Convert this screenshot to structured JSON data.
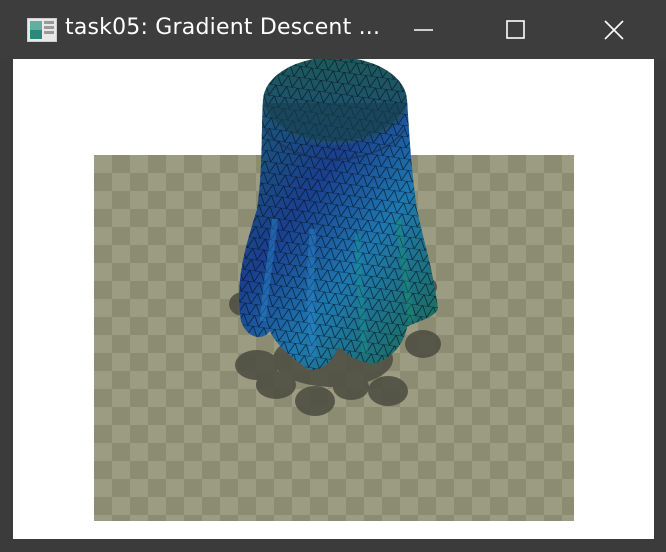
{
  "window": {
    "title": "task05: Gradient Descent ...",
    "controls": {
      "minimize": "minimize",
      "maximize": "maximize",
      "close": "close"
    }
  },
  "scene": {
    "floor_colors": [
      "#8c8c73",
      "#9c9c82"
    ],
    "cloth_colors": [
      "#1a3f8f",
      "#1e7a9a",
      "#1b6a4a"
    ],
    "shadow_color": "#4c4c40",
    "description_items": [
      "checkerboard-floor",
      "draped-cloth-mesh",
      "cloth-shadow"
    ]
  }
}
